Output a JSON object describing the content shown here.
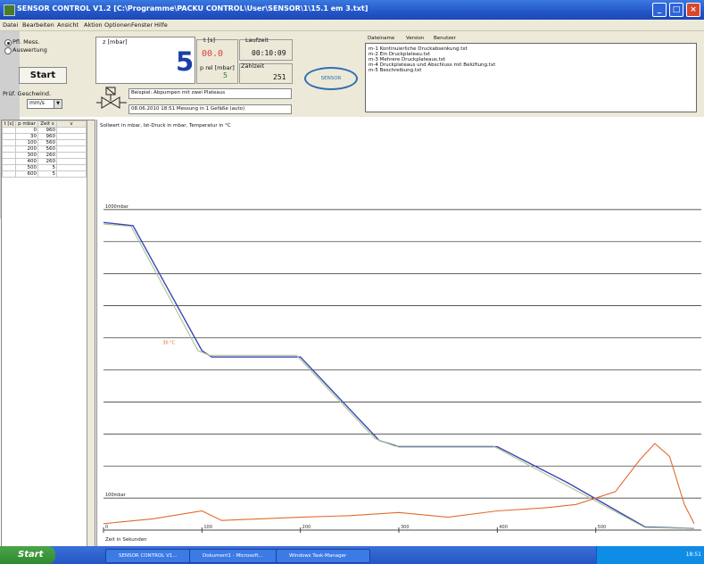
{
  "window": {
    "title": "SENSOR CONTROL V1.2 [C:\\Programme\\PACKU CONTROL\\User\\SENSOR\\1\\15.1 em 3.txt]",
    "min_label": "_",
    "max_label": "□",
    "close_label": "×"
  },
  "menu": [
    "Datei",
    "Bearbeiten",
    "Ansicht",
    "Aktion",
    "Optionen",
    "Fenster",
    "Hilfe"
  ],
  "mode": {
    "option1": "Pfl. Mess.",
    "option2": "Auswertung",
    "selected": 1
  },
  "start_label": "Start",
  "speed": {
    "label": "Prüf. Geschwind.",
    "value": "mm/s"
  },
  "display": {
    "main_label": "z [mbar]",
    "main_value": "5",
    "t_label": "t [s]",
    "t_value": "00.0",
    "pabs_label": "p rel [mbar]",
    "pabs_value": "5",
    "runtime_label": "Laufzeit",
    "runtime_value": "00:10:09",
    "count_label": "Zählzeit",
    "count_value": "251"
  },
  "logo_text": "SENSOR",
  "desc": {
    "line1": "Beispiel: Abpumpen mit zwei Plateaus",
    "line2": "08.06.2010 18:51 Messung in 1 Gefäße (auto)"
  },
  "programs": {
    "header1": "Dateiname",
    "header2": "Version",
    "header3": "Benutzer",
    "items": [
      "m-1 Kontinuierliche Druckabsenkung.txt",
      "m-2 Ein Druckplateau.txt",
      "m-3 Mehrere Druckplateaus.txt",
      "m-4 Druckplateaus und Abschluss mit Belüftung.txt",
      "m-5 Beschreibung.txt"
    ]
  },
  "table": {
    "headers": [
      "t [s]",
      "p mbar",
      "Zeit s",
      "v"
    ],
    "rows": [
      [
        "0",
        "960",
        "",
        ""
      ],
      [
        "30",
        "960",
        "",
        ""
      ],
      [
        "100",
        "560",
        "",
        ""
      ],
      [
        "200",
        "560",
        "",
        ""
      ],
      [
        "300",
        "260",
        "",
        ""
      ],
      [
        "400",
        "260",
        "",
        ""
      ],
      [
        "500",
        "5",
        "",
        ""
      ],
      [
        "600",
        "5",
        "",
        ""
      ]
    ]
  },
  "chart_data": {
    "type": "line",
    "legend_text": "Sollwert in mbar, Ist-Druck in mbar, Temperatur in °C",
    "xlabel": "Zeit in Sekunden",
    "x_ticks": [
      "0",
      "100",
      "200",
      "300",
      "400",
      "500"
    ],
    "y_ref_labels": {
      "top": "1000mbar",
      "bottom": "100mbar",
      "temp": "30 °C"
    },
    "xlim": [
      0,
      600
    ],
    "ylim": [
      0,
      1100
    ],
    "series": [
      {
        "color": "#3b46b8",
        "x": [
          0,
          30,
          100,
          110,
          200,
          280,
          300,
          400,
          470,
          550,
          600
        ],
        "y": [
          960,
          950,
          560,
          540,
          540,
          280,
          260,
          260,
          150,
          10,
          5
        ]
      },
      {
        "color": "#a9c48e",
        "x": [
          0,
          28,
          96,
          108,
          196,
          276,
          296,
          396,
          470,
          550,
          600
        ],
        "y": [
          955,
          948,
          560,
          545,
          545,
          285,
          262,
          262,
          140,
          8,
          5
        ]
      },
      {
        "color": "#e36a2e",
        "x": [
          0,
          50,
          100,
          120,
          200,
          250,
          300,
          350,
          400,
          450,
          480,
          520,
          545,
          560,
          575,
          590,
          600
        ],
        "y": [
          20,
          35,
          60,
          30,
          40,
          45,
          55,
          40,
          60,
          70,
          80,
          120,
          220,
          270,
          230,
          80,
          20
        ]
      }
    ]
  },
  "taskbar": {
    "start_label": "Start",
    "tasks": [
      "SENSOR CONTROL V1...",
      "Dokument1 - Microsoft...",
      "Windows Task-Manager"
    ],
    "clock": "18:51"
  },
  "colors": {
    "accent": "#1a3fa8",
    "titlebar": "#2356c8",
    "panel": "#ece9d8",
    "logo": "#2f6fb0"
  }
}
